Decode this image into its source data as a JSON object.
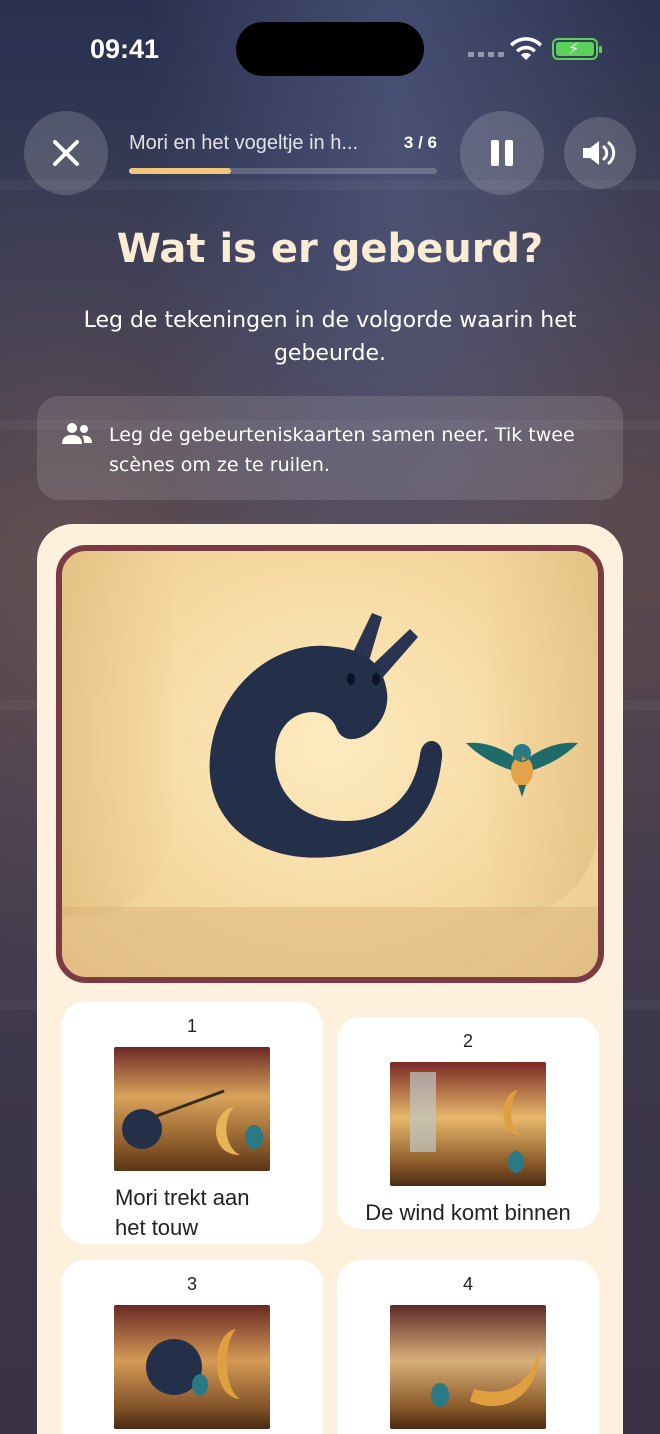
{
  "status_bar": {
    "time": "09:41"
  },
  "header": {
    "story_title": "Mori en het vogeltje in h...",
    "step": "3 / 6",
    "progress": 0.33
  },
  "heading": "Wat is er gebeurd?",
  "subtitle": "Leg de tekeningen in de volgorde waarin het gebeurde.",
  "hint": {
    "icon": "people-icon",
    "text": "Leg de gebeurteniskaarten samen neer. Tik twee scènes om ze te ruilen."
  },
  "scene": {
    "frame_color": "#7a3b44"
  },
  "cards": [
    {
      "number": "1",
      "caption": "Mori trekt aan het touw"
    },
    {
      "number": "2",
      "caption": "De wind komt binnen"
    },
    {
      "number": "3",
      "caption": ""
    },
    {
      "number": "4",
      "caption": ""
    }
  ],
  "colors": {
    "accent": "#f1c77b",
    "panel": "#fdf1dd",
    "heading": "#fbecd4"
  }
}
